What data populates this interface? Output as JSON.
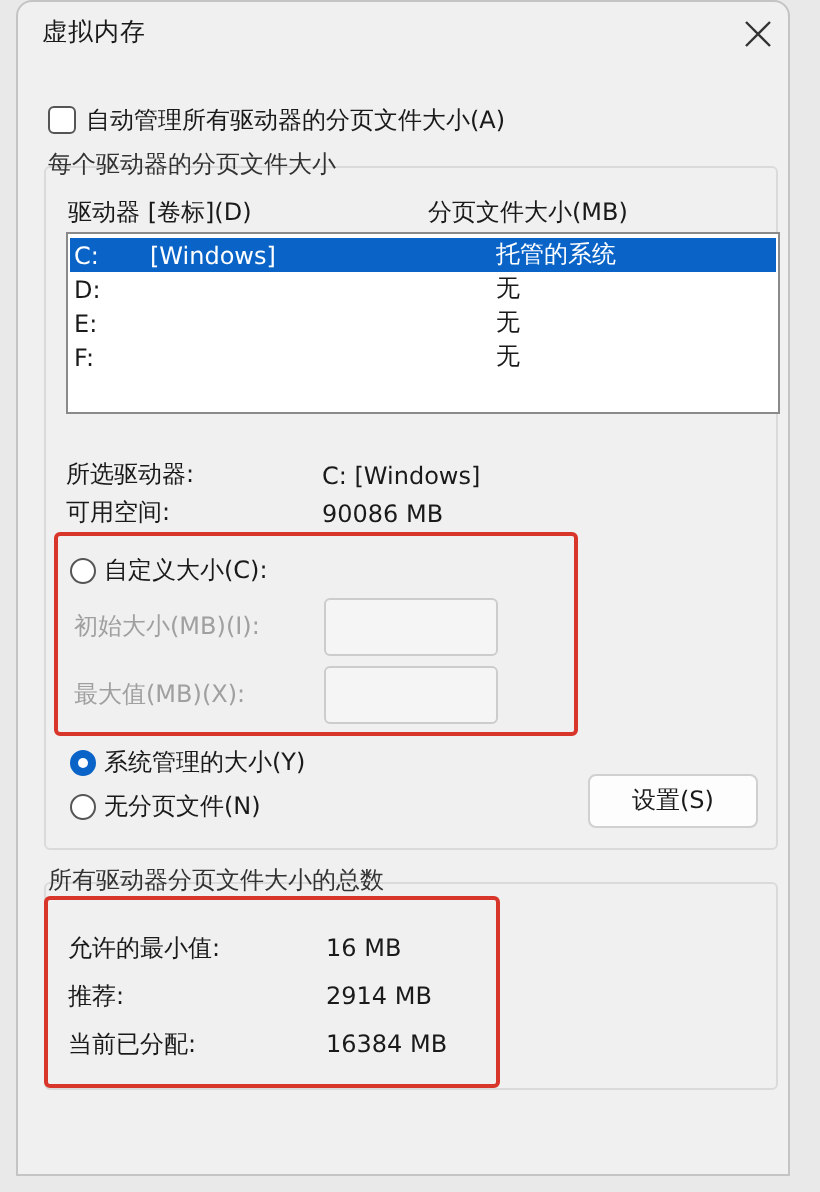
{
  "window": {
    "title": "虚拟内存"
  },
  "auto_manage": {
    "label": "自动管理所有驱动器的分页文件大小(A)",
    "checked": false
  },
  "per_drive": {
    "title": "每个驱动器的分页文件大小",
    "columns": [
      "驱动器 [卷标](D)",
      "分页文件大小(MB)"
    ],
    "drives": [
      {
        "drive": "C:",
        "volume": "[Windows]",
        "size": "托管的系统",
        "selected": true
      },
      {
        "drive": "D:",
        "size": "无",
        "selected": false
      },
      {
        "drive": "E:",
        "size": "无",
        "selected": false
      },
      {
        "drive": "F:",
        "size": "无",
        "selected": false
      }
    ],
    "info": [
      {
        "label": "所选驱动器:",
        "value": "C:  [Windows]"
      },
      {
        "label": "可用空间:",
        "value": "90086 MB"
      }
    ],
    "custom_size": {
      "label": "自定义大小(C):",
      "selected": false
    },
    "fields": [
      {
        "label": "初始大小(MB)(I):",
        "disabled": true
      },
      {
        "label": "最大值(MB)(X):",
        "disabled": true
      }
    ],
    "system_managed": {
      "label": "系统管理的大小(Y)",
      "selected": true
    },
    "no_paging": {
      "label": "无分页文件(N)",
      "selected": false
    },
    "set_button": "设置(S)"
  },
  "totals": {
    "title": "所有驱动器分页文件大小的总数",
    "rows": [
      {
        "label": "允许的最小值:",
        "value": "16 MB"
      },
      {
        "label": "推荐:",
        "value": "2914 MB"
      },
      {
        "label": "当前已分配:",
        "value": "16384 MB"
      }
    ]
  }
}
